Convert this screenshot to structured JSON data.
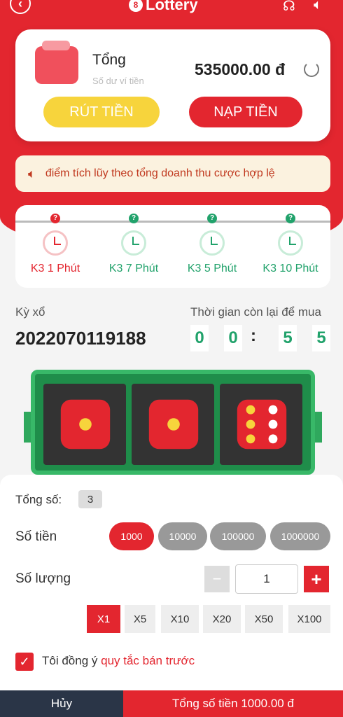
{
  "header": {
    "back_icon": "chevron-left-icon",
    "brand": "Lottery",
    "brand_badge": "8",
    "support_icon": "headset-icon",
    "sound_icon": "speaker-icon"
  },
  "wallet": {
    "title": "Tổng",
    "subtitle": "Số dư ví tiền",
    "amount": "535000.00 đ",
    "withdraw_label": "RÚT TIỀN",
    "deposit_label": "NẠP TIỀN"
  },
  "notice": {
    "text": "điểm tích lũy theo tổng doanh thu cược hợp lệ"
  },
  "games": [
    {
      "label": "K3 1 Phút",
      "active": true
    },
    {
      "label": "K3 7 Phút",
      "active": false
    },
    {
      "label": "K3 5 Phút",
      "active": false
    },
    {
      "label": "K3 10 Phút",
      "active": false
    }
  ],
  "draw": {
    "label": "Kỳ xổ",
    "id": "2022070119188",
    "timer_label": "Thời gian còn lại để mua",
    "digits": [
      "0",
      "0",
      "5",
      "5"
    ],
    "separator": ":"
  },
  "dice": [
    {
      "face": 1,
      "pip_color": "#f7d43c"
    },
    {
      "face": 1,
      "pip_color": "#f7d43c"
    },
    {
      "face": 6,
      "pip_color": "#f7d43c"
    }
  ],
  "bet": {
    "total_count_label": "Tổng số:",
    "total_count": "3",
    "amount_label": "Số tiền",
    "amounts": [
      "1000",
      "10000",
      "100000",
      "1000000"
    ],
    "selected_amount": "1000",
    "quantity_label": "Số lượng",
    "quantity_value": "1",
    "minus": "−",
    "plus": "+",
    "multipliers": [
      "X1",
      "X5",
      "X10",
      "X20",
      "X50",
      "X100"
    ],
    "selected_multiplier": "X1",
    "agree_text": "Tôi đồng ý ",
    "agree_link": "quy tắc bán trước",
    "checkmark": "✓"
  },
  "footer": {
    "cancel_label": "Hủy",
    "total_label": "Tổng số tiền 1000.00 đ"
  },
  "colors": {
    "primary": "#e3262f",
    "green": "#21a26b",
    "yellow": "#f7d43c"
  }
}
